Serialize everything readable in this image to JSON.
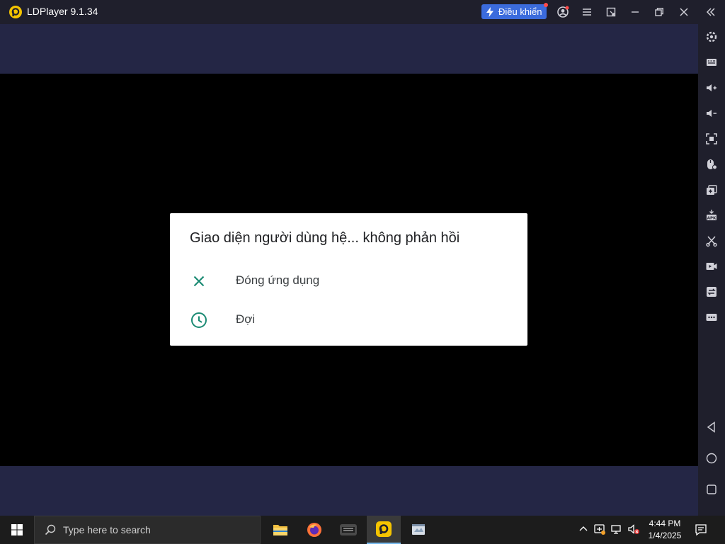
{
  "window": {
    "title": "LDPlayer 9.1.34",
    "control_button": "Điều khiển"
  },
  "dialog": {
    "title": "Giao diện người dùng hệ... không phản hồi",
    "options": [
      {
        "label": "Đóng ứng dụng",
        "icon": "close-icon"
      },
      {
        "label": "Đợi",
        "icon": "clock-icon"
      }
    ]
  },
  "taskbar": {
    "search_placeholder": "Type here to search",
    "time": "4:44 PM",
    "date": "1/4/2025"
  },
  "colors": {
    "accent": "#3b6bdc",
    "dialog_icon": "#1a8a73",
    "frame_band": "#242645"
  }
}
